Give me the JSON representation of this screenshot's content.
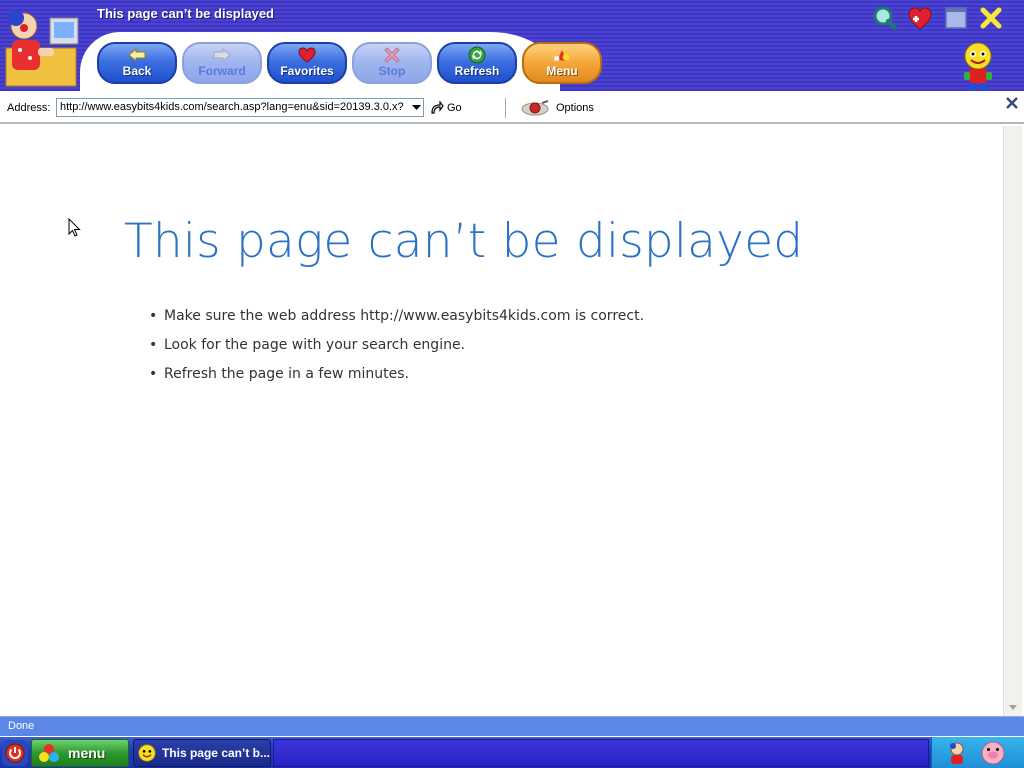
{
  "window": {
    "title": "This page can’t be displayed"
  },
  "toolbar": {
    "buttons": [
      {
        "label": "Back",
        "icon": "arrow-left-icon",
        "state": "enabled"
      },
      {
        "label": "Forward",
        "icon": "arrow-right-icon",
        "state": "disabled"
      },
      {
        "label": "Favorites",
        "icon": "heart-icon",
        "state": "enabled"
      },
      {
        "label": "Stop",
        "icon": "stop-x-icon",
        "state": "disabled"
      },
      {
        "label": "Refresh",
        "icon": "refresh-icon",
        "state": "enabled"
      },
      {
        "label": "Menu",
        "icon": "shapes-icon",
        "state": "enabled"
      }
    ]
  },
  "window_controls": [
    "search-icon",
    "add-favorite-icon",
    "maximize-icon",
    "close-icon"
  ],
  "address_bar": {
    "label": "Address:",
    "url": "http://www.easybits4kids.com/search.asp?lang=enu&sid=20139.3.0.x?",
    "go_label": "Go",
    "options_label": "Options"
  },
  "error_page": {
    "title": "This page can’t be displayed",
    "suggestions": [
      "Make sure the web address http://www.easybits4kids.com is correct.",
      "Look for the page with your search engine.",
      "Refresh the page in a few minutes."
    ]
  },
  "status": {
    "text": "Done"
  },
  "taskbar": {
    "menu_label": "menu",
    "task_label": "This page can’t b..."
  },
  "colors": {
    "title_band": "#4039c8",
    "error_title": "#2b72c6",
    "status_bar": "#5d87e6",
    "taskbar": "#1e3fc0"
  }
}
